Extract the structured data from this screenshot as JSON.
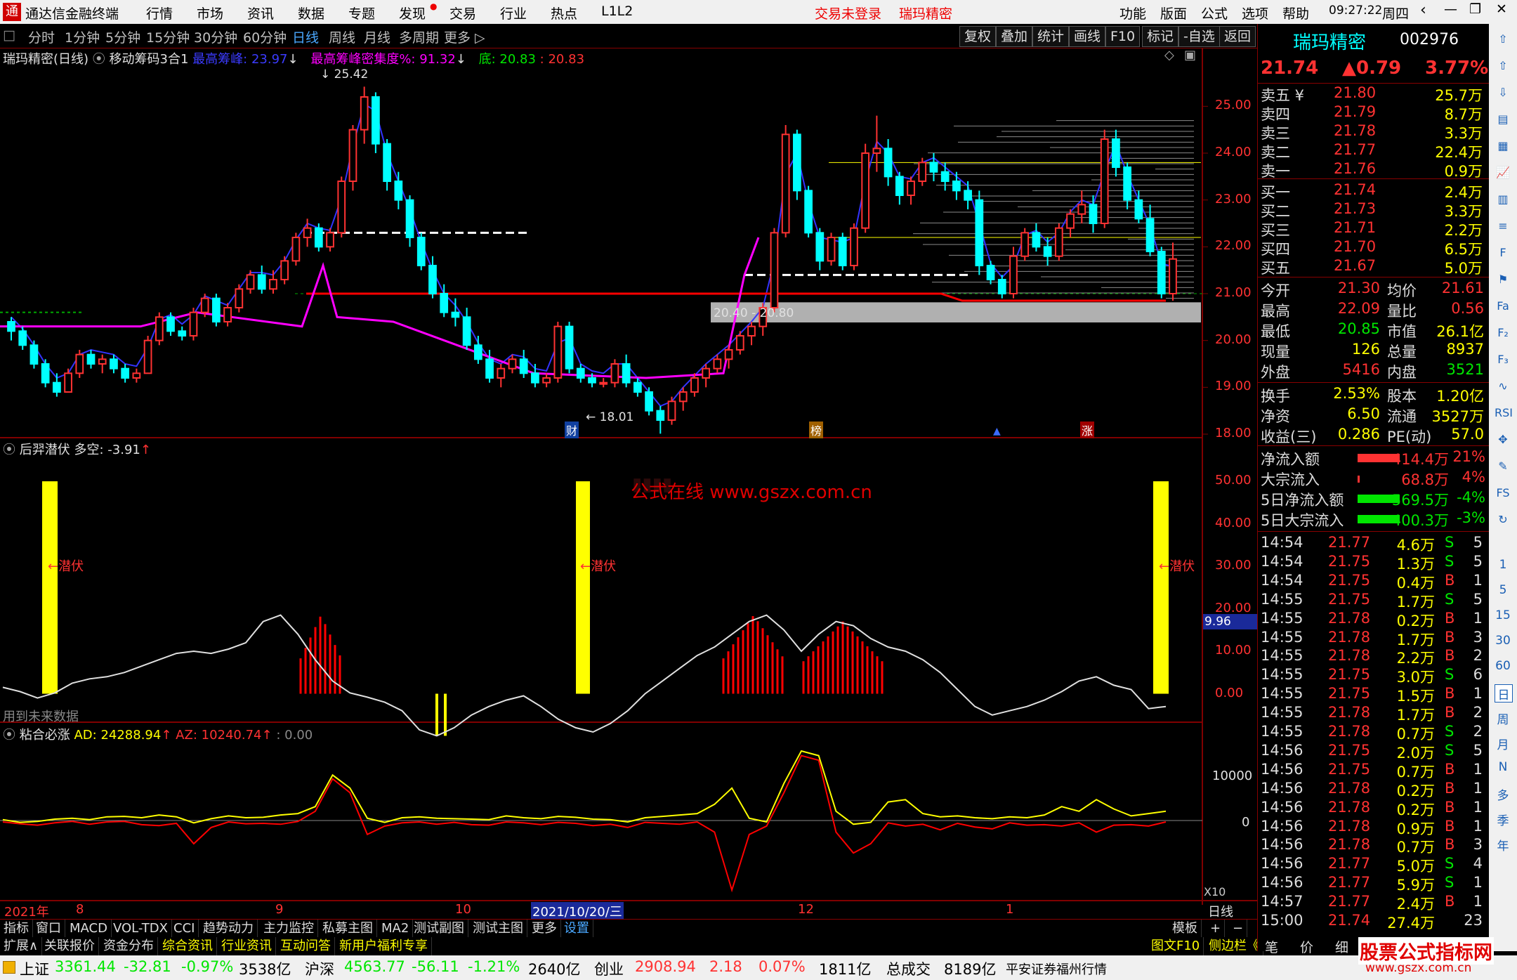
{
  "app": {
    "title": "通达信金融终端",
    "menu": [
      "行情",
      "市场",
      "资讯",
      "数据",
      "专题",
      "发现",
      "交易",
      "行业",
      "热点",
      "L1L2"
    ],
    "login_status": "交易未登录",
    "stock_name_top": "瑞玛精密",
    "right_menu": [
      "功能",
      "版面",
      "公式",
      "选项",
      "帮助"
    ],
    "time": "09:27:22",
    "weekday": "周四"
  },
  "period_tabs": [
    "分时",
    "1分钟",
    "5分钟",
    "15分钟",
    "30分钟",
    "60分钟",
    "日线",
    "周线",
    "月线",
    "多周期",
    "更多 ▷"
  ],
  "active_period": "日线",
  "chart_tools": [
    "复权",
    "叠加",
    "统计",
    "画线",
    "F10",
    "标记",
    "-自选",
    "返回"
  ],
  "main_chart": {
    "header_name": "瑞玛精密(日线)",
    "indicator_name": "移动筹码3合1",
    "peak_label": "最高筹峰:",
    "peak_value": "23.97",
    "density_label": "最高筹峰密集度%:",
    "density_value": "91.32",
    "bottom_label": "底:",
    "bottom_value": "20.83",
    "bottom_value2": "20.83",
    "high_marker": "25.42",
    "low_marker": "18.01",
    "range_label": "20.40 - 20.80",
    "markers": [
      "财",
      "榜",
      "涨"
    ],
    "y_ticks": [
      "25.00",
      "24.00",
      "23.00",
      "22.00",
      "21.00",
      "20.00",
      "19.00",
      "18.00"
    ]
  },
  "sub1": {
    "name": "后羿潜伏",
    "label": "多空:",
    "value": "-3.91",
    "signal_text": "潜伏",
    "current_value": "9.96",
    "note": "用到未来数据",
    "y_ticks": [
      "50.00",
      "40.00",
      "30.00",
      "20.00",
      "10.00",
      "0.00"
    ],
    "watermark_line1": "公式在线 www.gszx.com.cn"
  },
  "sub2": {
    "name": "粘合必涨",
    "ad_label": "AD:",
    "ad_value": "24288.94",
    "az_label": "AZ:",
    "az_value": "10240.74",
    "third_value": "0.00",
    "y_ticks": [
      "10000",
      "0"
    ],
    "scale_label": "X10"
  },
  "time_axis": {
    "labels": [
      "2021年",
      "8",
      "9",
      "10",
      "2021/10/20/三",
      "12",
      "1"
    ],
    "period_label": "日线"
  },
  "bottom_tabs": [
    "指标",
    "窗口",
    "MACD",
    "VOL-TDX",
    "CCI",
    "趋势动力",
    "主力监控",
    "私募主图",
    "MA2",
    "测试副图",
    "测试主图",
    "更多",
    "设置"
  ],
  "bottom_tabs_right": [
    "模板",
    "+",
    "−"
  ],
  "bottom_tabs2": [
    "扩展∧",
    "关联报价",
    "资金分布",
    "综合资讯",
    "行业资讯",
    "互动问答",
    "新用户福利专享"
  ],
  "bottom_tabs2_right": [
    "图文F10",
    "侧边栏《"
  ],
  "quote": {
    "name": "瑞玛精密",
    "code": "002976",
    "price": "21.74",
    "change": "▲0.79",
    "pct": "3.77%",
    "asks": [
      {
        "label": "卖五 ¥",
        "price": "21.80",
        "vol": "25.7万"
      },
      {
        "label": "卖四",
        "price": "21.79",
        "vol": "8.7万"
      },
      {
        "label": "卖三",
        "price": "21.78",
        "vol": "3.3万"
      },
      {
        "label": "卖二",
        "price": "21.77",
        "vol": "22.4万"
      },
      {
        "label": "卖一",
        "price": "21.76",
        "vol": "0.9万"
      }
    ],
    "bids": [
      {
        "label": "买一",
        "price": "21.74",
        "vol": "2.4万"
      },
      {
        "label": "买二",
        "price": "21.73",
        "vol": "3.3万"
      },
      {
        "label": "买三",
        "price": "21.71",
        "vol": "2.2万"
      },
      {
        "label": "买四",
        "price": "21.70",
        "vol": "6.5万"
      },
      {
        "label": "买五",
        "price": "21.67",
        "vol": "5.0万"
      }
    ],
    "stats": [
      {
        "l": "今开",
        "v": "21.30",
        "l2": "均价",
        "v2": "21.61"
      },
      {
        "l": "最高",
        "v": "22.09",
        "l2": "量比",
        "v2": "0.56"
      },
      {
        "l": "最低",
        "v": "20.85",
        "l2": "市值",
        "v2": "26.1亿"
      },
      {
        "l": "现量",
        "v": "126",
        "l2": "总量",
        "v2": "8937"
      },
      {
        "l": "外盘",
        "v": "5416",
        "l2": "内盘",
        "v2": "3521"
      }
    ],
    "stats2": [
      {
        "l": "换手",
        "v": "2.53%",
        "l2": "股本",
        "v2": "1.20亿"
      },
      {
        "l": "净资",
        "v": "6.50",
        "l2": "流通",
        "v2": "3527万"
      },
      {
        "l": "收益(三)",
        "v": "0.286",
        "l2": "PE(动)",
        "v2": "57.0"
      }
    ],
    "flows": [
      {
        "l": "净流入额",
        "v": "414.4万",
        "p": "21%"
      },
      {
        "l": "大宗流入",
        "v": "68.8万",
        "p": "4%"
      },
      {
        "l": "5日净流入额",
        "v": "-569.5万",
        "p": "-4%"
      },
      {
        "l": "5日大宗流入",
        "v": "-400.3万",
        "p": "-3%"
      }
    ],
    "ticks": [
      {
        "t": "14:54",
        "p": "21.77",
        "v": "4.6万",
        "d": "S",
        "n": "5"
      },
      {
        "t": "14:54",
        "p": "21.75",
        "v": "1.3万",
        "d": "S",
        "n": "5"
      },
      {
        "t": "14:54",
        "p": "21.75",
        "v": "0.4万",
        "d": "B",
        "n": "1"
      },
      {
        "t": "14:55",
        "p": "21.75",
        "v": "1.7万",
        "d": "S",
        "n": "5"
      },
      {
        "t": "14:55",
        "p": "21.78",
        "v": "0.2万",
        "d": "B",
        "n": "1"
      },
      {
        "t": "14:55",
        "p": "21.78",
        "v": "1.7万",
        "d": "B",
        "n": "3"
      },
      {
        "t": "14:55",
        "p": "21.78",
        "v": "2.2万",
        "d": "B",
        "n": "2"
      },
      {
        "t": "14:55",
        "p": "21.75",
        "v": "3.0万",
        "d": "S",
        "n": "6"
      },
      {
        "t": "14:55",
        "p": "21.75",
        "v": "1.5万",
        "d": "B",
        "n": "1"
      },
      {
        "t": "14:55",
        "p": "21.78",
        "v": "1.7万",
        "d": "B",
        "n": "2"
      },
      {
        "t": "14:55",
        "p": "21.78",
        "v": "0.7万",
        "d": "S",
        "n": "2"
      },
      {
        "t": "14:56",
        "p": "21.75",
        "v": "2.0万",
        "d": "S",
        "n": "5"
      },
      {
        "t": "14:56",
        "p": "21.75",
        "v": "0.7万",
        "d": "B",
        "n": "1"
      },
      {
        "t": "14:56",
        "p": "21.78",
        "v": "0.2万",
        "d": "B",
        "n": "1"
      },
      {
        "t": "14:56",
        "p": "21.78",
        "v": "0.2万",
        "d": "B",
        "n": "1"
      },
      {
        "t": "14:56",
        "p": "21.78",
        "v": "0.9万",
        "d": "B",
        "n": "1"
      },
      {
        "t": "14:56",
        "p": "21.78",
        "v": "0.7万",
        "d": "B",
        "n": "3"
      },
      {
        "t": "14:56",
        "p": "21.77",
        "v": "5.0万",
        "d": "S",
        "n": "4"
      },
      {
        "t": "14:56",
        "p": "21.77",
        "v": "5.9万",
        "d": "S",
        "n": "1"
      },
      {
        "t": "14:57",
        "p": "21.77",
        "v": "2.4万",
        "d": "B",
        "n": "1"
      },
      {
        "t": "15:00",
        "p": "21.74",
        "v": "27.4万",
        "d": "",
        "n": "23"
      }
    ],
    "tick_tabs": [
      "笔",
      "价",
      "细"
    ]
  },
  "sidebar_periods": [
    "1",
    "5",
    "15",
    "30",
    "60",
    "日",
    "周",
    "月",
    "N",
    "多",
    "季",
    "年"
  ],
  "sidebar_icons": [
    "up-arrow-icon",
    "up-arrow-icon",
    "down-arrow-icon",
    "news-icon",
    "grid-icon",
    "chart-icon",
    "candle-icon",
    "list-icon",
    "f10-icon",
    "flag-icon",
    "fa-icon",
    "f2-icon",
    "f3-icon",
    "wave-icon",
    "rsi-icon",
    "move-icon",
    "pencil-icon",
    "fs-icon",
    "refresh-icon"
  ],
  "status": {
    "sh_name": "上证",
    "sh_val": "3361.44",
    "sh_chg": "-32.81",
    "sh_pct": "-0.97%",
    "sh_amt": "3538亿",
    "sz_name": "沪深",
    "sz_val": "4563.77",
    "sz_chg": "-56.11",
    "sz_pct": "-1.21%",
    "sz_amt": "2640亿",
    "cy_name": "创业",
    "cy_val": "2908.94",
    "cy_chg": "2.18",
    "cy_pct": "0.07%",
    "cy_amt": "1811亿",
    "total_label": "总成交",
    "total_val": "8189亿",
    "broker": "平安证券福州行情",
    "logo_text": "股票公式指标网",
    "logo_url": "www.gszx.com.cn"
  },
  "colors": {
    "up": "#ff3232",
    "down": "#00ffff",
    "axis": "#800000",
    "yellow": "#ffff00",
    "magenta": "#ff00ff",
    "blue": "#3333ff",
    "white": "#e0e0e0"
  },
  "chart_data": {
    "type": "candlestick",
    "price_axis": [
      18,
      25.4
    ],
    "candles": [
      [
        20.4,
        20.5,
        20.0,
        20.2
      ],
      [
        20.2,
        20.3,
        19.8,
        19.9
      ],
      [
        19.9,
        20.0,
        19.4,
        19.5
      ],
      [
        19.5,
        19.6,
        19.0,
        19.1
      ],
      [
        19.1,
        19.3,
        18.8,
        18.9
      ],
      [
        18.9,
        19.4,
        18.9,
        19.3
      ],
      [
        19.3,
        19.8,
        19.2,
        19.7
      ],
      [
        19.7,
        19.8,
        19.4,
        19.5
      ],
      [
        19.5,
        19.7,
        19.3,
        19.6
      ],
      [
        19.6,
        19.7,
        19.3,
        19.4
      ],
      [
        19.4,
        19.5,
        19.1,
        19.2
      ],
      [
        19.2,
        19.4,
        19.1,
        19.3
      ],
      [
        19.3,
        20.1,
        19.3,
        20.0
      ],
      [
        20.0,
        20.6,
        19.9,
        20.5
      ],
      [
        20.5,
        20.6,
        20.1,
        20.2
      ],
      [
        20.2,
        20.3,
        20.0,
        20.1
      ],
      [
        20.1,
        20.7,
        20.0,
        20.6
      ],
      [
        20.6,
        21.0,
        20.5,
        20.9
      ],
      [
        20.9,
        21.0,
        20.3,
        20.4
      ],
      [
        20.4,
        20.8,
        20.3,
        20.7
      ],
      [
        20.7,
        21.2,
        20.6,
        21.1
      ],
      [
        21.1,
        21.5,
        21.0,
        21.4
      ],
      [
        21.4,
        21.6,
        21.0,
        21.1
      ],
      [
        21.1,
        21.5,
        21.0,
        21.3
      ],
      [
        21.3,
        21.8,
        21.2,
        21.7
      ],
      [
        21.7,
        22.3,
        21.6,
        22.2
      ],
      [
        22.2,
        22.6,
        22.0,
        22.4
      ],
      [
        22.4,
        22.5,
        21.9,
        22.0
      ],
      [
        22.0,
        22.4,
        21.9,
        22.3
      ],
      [
        22.3,
        23.5,
        22.2,
        23.4
      ],
      [
        23.4,
        24.6,
        23.2,
        24.5
      ],
      [
        24.5,
        25.42,
        24.2,
        25.2
      ],
      [
        25.2,
        25.3,
        24.0,
        24.2
      ],
      [
        24.2,
        24.3,
        23.2,
        23.4
      ],
      [
        23.4,
        23.6,
        22.8,
        23.0
      ],
      [
        23.0,
        23.1,
        22.0,
        22.2
      ],
      [
        22.2,
        22.3,
        21.5,
        21.6
      ],
      [
        21.6,
        21.8,
        20.9,
        21.0
      ],
      [
        21.0,
        21.2,
        20.5,
        20.6
      ],
      [
        20.6,
        20.9,
        20.3,
        20.5
      ],
      [
        20.5,
        20.7,
        19.8,
        19.9
      ],
      [
        19.9,
        20.1,
        19.5,
        19.6
      ],
      [
        19.6,
        19.8,
        19.1,
        19.2
      ],
      [
        19.2,
        19.5,
        19.0,
        19.4
      ],
      [
        19.4,
        19.7,
        19.3,
        19.6
      ],
      [
        19.6,
        19.8,
        19.2,
        19.3
      ],
      [
        19.3,
        19.5,
        19.0,
        19.1
      ],
      [
        19.1,
        19.3,
        19.0,
        19.2
      ],
      [
        19.2,
        20.4,
        19.1,
        20.3
      ],
      [
        20.3,
        20.4,
        19.3,
        19.4
      ],
      [
        19.4,
        19.5,
        19.1,
        19.2
      ],
      [
        19.2,
        19.3,
        19.0,
        19.1
      ],
      [
        19.1,
        19.2,
        19.0,
        19.1
      ],
      [
        19.1,
        19.6,
        19.0,
        19.5
      ],
      [
        19.5,
        19.7,
        19.0,
        19.1
      ],
      [
        19.1,
        19.2,
        18.8,
        18.9
      ],
      [
        18.9,
        19.0,
        18.4,
        18.5
      ],
      [
        18.5,
        18.6,
        18.01,
        18.3
      ],
      [
        18.3,
        18.8,
        18.2,
        18.7
      ],
      [
        18.7,
        19.0,
        18.5,
        18.9
      ],
      [
        18.9,
        19.3,
        18.8,
        19.2
      ],
      [
        19.2,
        19.5,
        19.0,
        19.4
      ],
      [
        19.4,
        19.7,
        19.3,
        19.6
      ],
      [
        19.6,
        19.9,
        19.4,
        19.8
      ],
      [
        19.8,
        20.2,
        19.7,
        20.1
      ],
      [
        20.1,
        20.4,
        19.9,
        20.3
      ],
      [
        20.3,
        20.8,
        20.1,
        20.7
      ],
      [
        20.7,
        22.4,
        20.6,
        22.3
      ],
      [
        22.3,
        24.6,
        22.2,
        24.4
      ],
      [
        24.4,
        24.5,
        23.0,
        23.2
      ],
      [
        23.2,
        23.3,
        22.2,
        22.3
      ],
      [
        22.3,
        22.4,
        21.5,
        21.7
      ],
      [
        21.7,
        22.3,
        21.6,
        22.2
      ],
      [
        22.2,
        22.3,
        21.5,
        21.6
      ],
      [
        21.6,
        22.5,
        21.5,
        22.4
      ],
      [
        22.4,
        24.2,
        22.3,
        24.0
      ],
      [
        24.0,
        24.8,
        23.6,
        24.1
      ],
      [
        24.1,
        24.3,
        23.3,
        23.5
      ],
      [
        23.5,
        23.6,
        22.9,
        23.1
      ],
      [
        23.1,
        23.5,
        22.9,
        23.4
      ],
      [
        23.4,
        23.9,
        23.3,
        23.8
      ],
      [
        23.8,
        24.0,
        23.4,
        23.6
      ],
      [
        23.6,
        23.8,
        23.2,
        23.4
      ],
      [
        23.4,
        23.6,
        23.0,
        23.2
      ],
      [
        23.2,
        23.4,
        22.8,
        23.0
      ],
      [
        23.0,
        23.2,
        21.4,
        21.6
      ],
      [
        21.6,
        21.7,
        21.2,
        21.3
      ],
      [
        21.3,
        21.4,
        20.9,
        21.0
      ],
      [
        21.0,
        22.0,
        20.9,
        21.8
      ],
      [
        21.8,
        22.4,
        21.7,
        22.3
      ],
      [
        22.3,
        22.5,
        21.9,
        22.0
      ],
      [
        22.0,
        22.2,
        21.6,
        21.8
      ],
      [
        21.8,
        22.5,
        21.7,
        22.4
      ],
      [
        22.4,
        22.8,
        22.2,
        22.7
      ],
      [
        22.7,
        23.2,
        22.5,
        22.9
      ],
      [
        22.9,
        23.1,
        22.3,
        22.5
      ],
      [
        22.5,
        24.5,
        22.4,
        24.3
      ],
      [
        24.3,
        24.5,
        23.5,
        23.7
      ],
      [
        23.7,
        23.8,
        22.8,
        23.0
      ],
      [
        23.0,
        23.2,
        22.5,
        22.6
      ],
      [
        22.6,
        22.9,
        21.8,
        21.9
      ],
      [
        21.9,
        22.0,
        20.9,
        21.0
      ],
      [
        21.0,
        22.09,
        20.85,
        21.74
      ]
    ],
    "sub1_line": [
      1.5,
      0.5,
      -1,
      0.2,
      2.5,
      3.5,
      4,
      5,
      6.5,
      8,
      9.5,
      10,
      9.5,
      10.5,
      12,
      17,
      18.5,
      14,
      8,
      3,
      0.2,
      -0.8,
      -2,
      -4,
      -8.5,
      -9.9,
      -8,
      -5,
      -3,
      -1.5,
      -0.5,
      -3,
      -6,
      -8,
      -9,
      -7,
      -4,
      0,
      3,
      6,
      9,
      11,
      14,
      17,
      18.5,
      15,
      10,
      14,
      17,
      16,
      13,
      11,
      10,
      8,
      5,
      1,
      -3,
      -5,
      -4,
      -3,
      -1.5,
      0.5,
      3,
      4,
      2,
      1,
      -3.5,
      -3
    ],
    "sub2_ad": [
      200,
      -400,
      -200,
      300,
      500,
      200,
      800,
      900,
      600,
      1200,
      800,
      -500,
      400,
      1000,
      600,
      700,
      1200,
      1500,
      3000,
      9800,
      7000,
      500,
      -400,
      600,
      800,
      500,
      400,
      300,
      200,
      1000,
      600,
      400,
      900,
      700,
      300,
      200,
      -300,
      600,
      900,
      1200,
      1500,
      3500,
      7000,
      500,
      -300,
      8000,
      15000,
      14000,
      2000,
      -800,
      -400,
      4000,
      4500,
      1500,
      800,
      1000,
      600,
      400,
      800,
      600,
      1200,
      3000,
      2000,
      4500,
      2500,
      1000,
      1500,
      2000
    ],
    "sub2_az": [
      -300,
      -700,
      -1000,
      -500,
      -200,
      -800,
      -300,
      -200,
      -900,
      -1100,
      -600,
      -5000,
      -1500,
      -300,
      -700,
      -600,
      -800,
      -200,
      2000,
      9000,
      6000,
      -3000,
      -1200,
      -500,
      -300,
      -800,
      -400,
      -900,
      -1000,
      -300,
      -500,
      -900,
      -400,
      -600,
      -1100,
      -800,
      -1500,
      -400,
      -600,
      -800,
      -300,
      -2500,
      -15000,
      -3000,
      -1200,
      6000,
      14000,
      13000,
      -2500,
      -7000,
      -5000,
      -500,
      -1200,
      -800,
      -2000,
      -600,
      -1400,
      -1800,
      -500,
      -1000,
      -900,
      -1200,
      -500,
      -2500,
      -1000,
      -900,
      -1200,
      -300
    ]
  }
}
